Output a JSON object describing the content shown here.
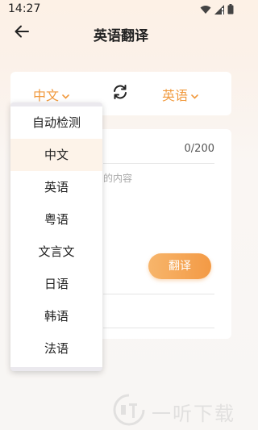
{
  "status": {
    "time": "14:27"
  },
  "header": {
    "title": "英语翻译"
  },
  "lang_bar": {
    "source": "中文",
    "target": "英语"
  },
  "input": {
    "count": "0/200",
    "placeholder_partial": "的内容"
  },
  "translate_button": "翻译",
  "dropdown": {
    "selected": "中文",
    "options": [
      "自动检测",
      "中文",
      "英语",
      "粤语",
      "文言文",
      "日语",
      "韩语",
      "法语"
    ]
  },
  "watermark": {
    "text": "一听下载"
  },
  "colors": {
    "accent": "#f19a3e",
    "button_from": "#f7b56b",
    "button_to": "#f39a45"
  }
}
